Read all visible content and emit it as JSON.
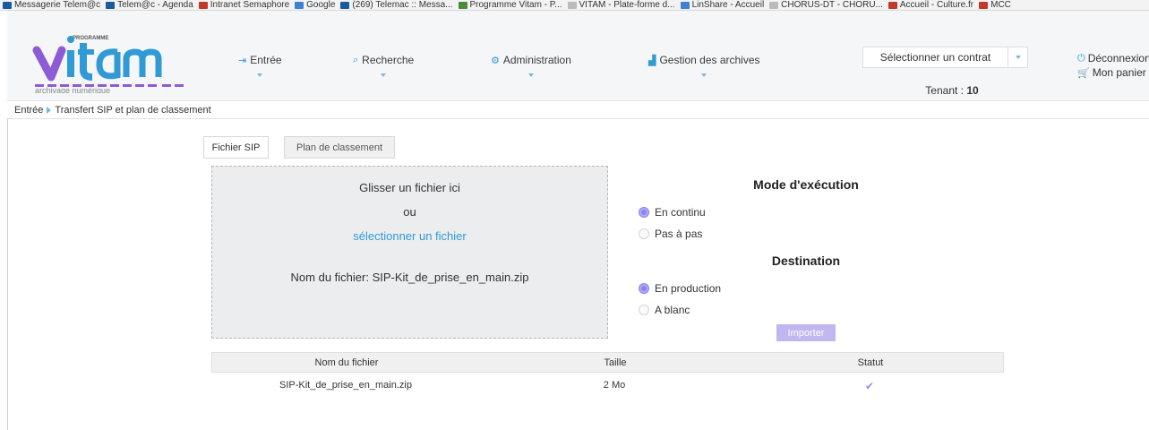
{
  "bookmarks": [
    {
      "label": "Messagerie Telem@c",
      "color": "#1a5aa0"
    },
    {
      "label": "Telem@c - Agenda",
      "color": "#1a5aa0"
    },
    {
      "label": "Intranet Semaphore",
      "color": "#c0392b"
    },
    {
      "label": "Google",
      "color": "#3f7fd4"
    },
    {
      "label": "(269) Telemac :: Messa...",
      "color": "#1a5aa0"
    },
    {
      "label": "Programme Vitam - P...",
      "color": "#4a8a3a"
    },
    {
      "label": "VITAM - Plate-forme d...",
      "color": "#999999"
    },
    {
      "label": "LinShare - Accueil",
      "color": "#3f7fd4"
    },
    {
      "label": "CHORUS-DT - CHORU...",
      "color": "#999999"
    },
    {
      "label": "Accueil - Culture.fr",
      "color": "#c0392b"
    },
    {
      "label": "MCC",
      "color": "#c0392b"
    }
  ],
  "logo": {
    "programme": "PROGRAMME",
    "name": "vitam",
    "tagline": "archivage numérique"
  },
  "nav": {
    "entree": "Entrée",
    "recherche": "Recherche",
    "administration": "Administration",
    "gestion": "Gestion des archives"
  },
  "contract": {
    "label": "Sélectionner un contrat"
  },
  "tenant": {
    "label": "Tenant :",
    "value": "10"
  },
  "user": {
    "logout": "Déconnexion",
    "basket": "Mon panier"
  },
  "breadcrumb": {
    "root": "Entrée",
    "current": "Transfert SIP et plan de classement"
  },
  "tabs": [
    {
      "label": "Fichier SIP"
    },
    {
      "label": "Plan de classement"
    }
  ],
  "dropzone": {
    "drag": "Glisser un fichier ici",
    "or": "ou",
    "select": "sélectionner un fichier",
    "filename_label": "Nom du fichier: SIP-Kit_de_prise_en_main.zip"
  },
  "mode": {
    "title": "Mode d'exécution",
    "options": [
      {
        "label": "En continu",
        "checked": true
      },
      {
        "label": "Pas à pas",
        "checked": false
      }
    ]
  },
  "destination": {
    "title": "Destination",
    "options": [
      {
        "label": "En production",
        "checked": true
      },
      {
        "label": "A blanc",
        "checked": false
      }
    ]
  },
  "import_label": "Importer",
  "table": {
    "headers": {
      "name": "Nom du fichier",
      "size": "Taille",
      "status": "Statut"
    },
    "rows": [
      {
        "name": "SIP-Kit_de_prise_en_main.zip",
        "size": "2 Mo",
        "status": "✔"
      }
    ]
  },
  "colors": {
    "accent": "#2f9ad6",
    "radio": "#8d83ee",
    "import": "#c2b6f1"
  }
}
